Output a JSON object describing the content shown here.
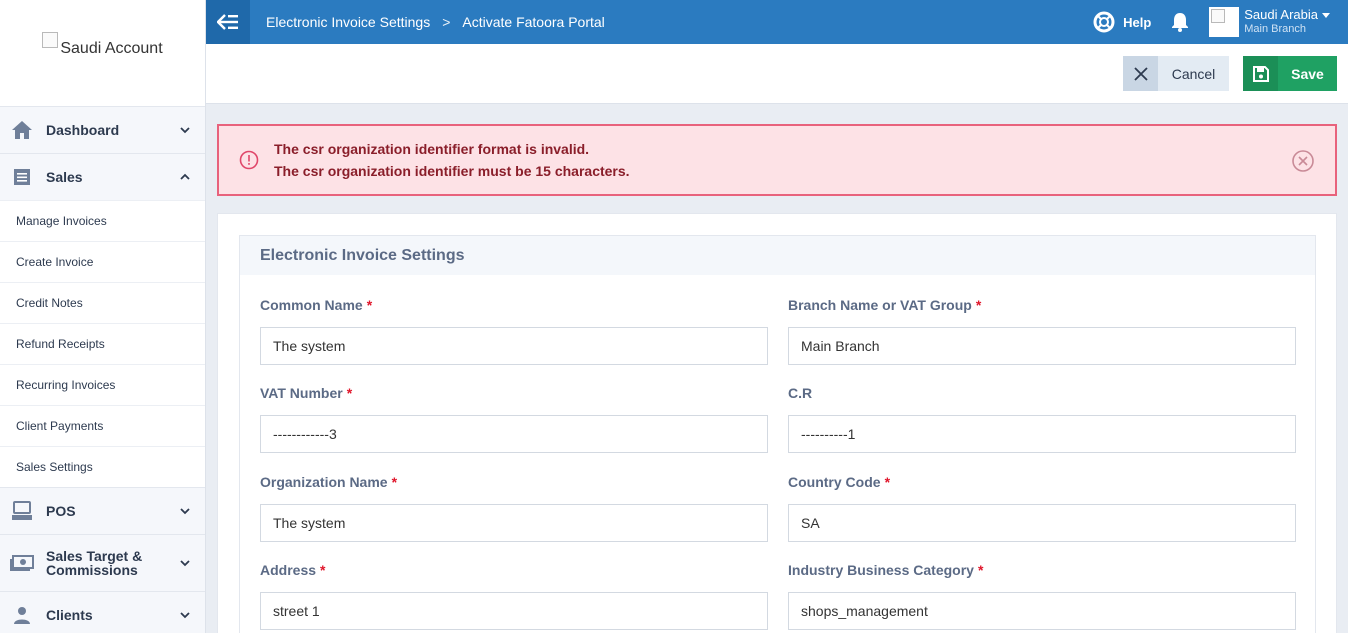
{
  "sidebar": {
    "logo_alt": "Saudi Account",
    "sections": [
      {
        "label": "Dashboard",
        "icon": "home-icon",
        "state": "collapsed"
      },
      {
        "label": "Sales",
        "icon": "receipt-icon",
        "state": "expanded"
      }
    ],
    "sales_items": [
      "Manage Invoices",
      "Create Invoice",
      "Credit Notes",
      "Refund Receipts",
      "Recurring Invoices",
      "Client Payments",
      "Sales Settings"
    ],
    "after": [
      {
        "label": "POS",
        "icon": "pos-icon"
      },
      {
        "label": "Sales Target & Commissions",
        "icon": "money-icon"
      },
      {
        "label": "Clients",
        "icon": "user-icon"
      }
    ]
  },
  "topbar": {
    "breadcrumb": [
      "Electronic Invoice Settings",
      "Activate Fatoora Portal"
    ],
    "separator": ">",
    "help_label": "Help",
    "account_name": "Saudi Arabia",
    "branch_name": "Main Branch"
  },
  "actions": {
    "cancel_label": "Cancel",
    "save_label": "Save"
  },
  "alert": {
    "messages": [
      "The csr organization identifier format is invalid.",
      "The csr organization identifier must be 15 characters."
    ]
  },
  "form": {
    "title": "Electronic Invoice Settings",
    "fields": {
      "common_name": {
        "label": "Common Name",
        "value": "The system"
      },
      "branch_name": {
        "label": "Branch Name or VAT Group",
        "value": "Main Branch"
      },
      "vat_number": {
        "label": "VAT Number",
        "value": "------------3"
      },
      "cr": {
        "label": "C.R",
        "value": "----------1"
      },
      "org_name": {
        "label": "Organization Name",
        "value": "The system"
      },
      "country_code": {
        "label": "Country Code",
        "value": "SA"
      },
      "address": {
        "label": "Address",
        "value": "street 1"
      },
      "industry": {
        "label": "Industry Business Category",
        "value": "shops_management"
      }
    }
  },
  "colors": {
    "topbar": "#2b7bc0",
    "save": "#1fa163",
    "alert_border": "#e8627c",
    "alert_bg": "#fde2e6"
  }
}
